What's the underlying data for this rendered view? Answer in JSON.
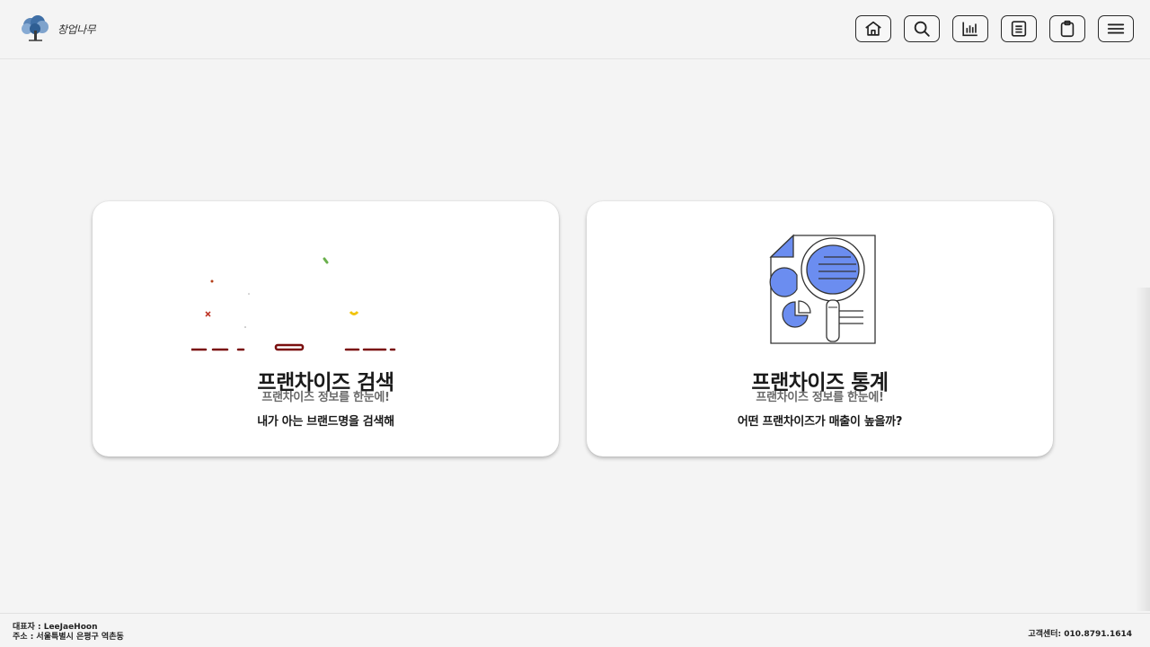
{
  "header": {
    "logo_text": "창업나무",
    "nav": [
      {
        "icon": "home-icon"
      },
      {
        "icon": "search-icon"
      },
      {
        "icon": "bar-chart-icon"
      },
      {
        "icon": "list-icon"
      },
      {
        "icon": "clipboard-icon"
      },
      {
        "icon": "menu-icon"
      }
    ]
  },
  "cards": {
    "search": {
      "title": "프랜차이즈 검색",
      "subtitle": "프랜차이즈 정보를 한눈에!",
      "description": "내가 아는 브랜드명을 검색해"
    },
    "stats": {
      "title": "프랜차이즈 통계",
      "subtitle": "프랜차이즈 정보를 한눈에!",
      "description": "어떤 프랜차이즈가 매출이 높을까?"
    }
  },
  "footer": {
    "representative": "대표자 : LeeJaeHoon",
    "address": "주소 : 서울특별시 은평구 역촌동",
    "customer_center": "고객센터: 010.8791.1614"
  },
  "colors": {
    "background": "#f4f4f4",
    "card": "#ffffff",
    "accent_blue": "#6b8df0",
    "dark_red": "#7a0f0f"
  }
}
